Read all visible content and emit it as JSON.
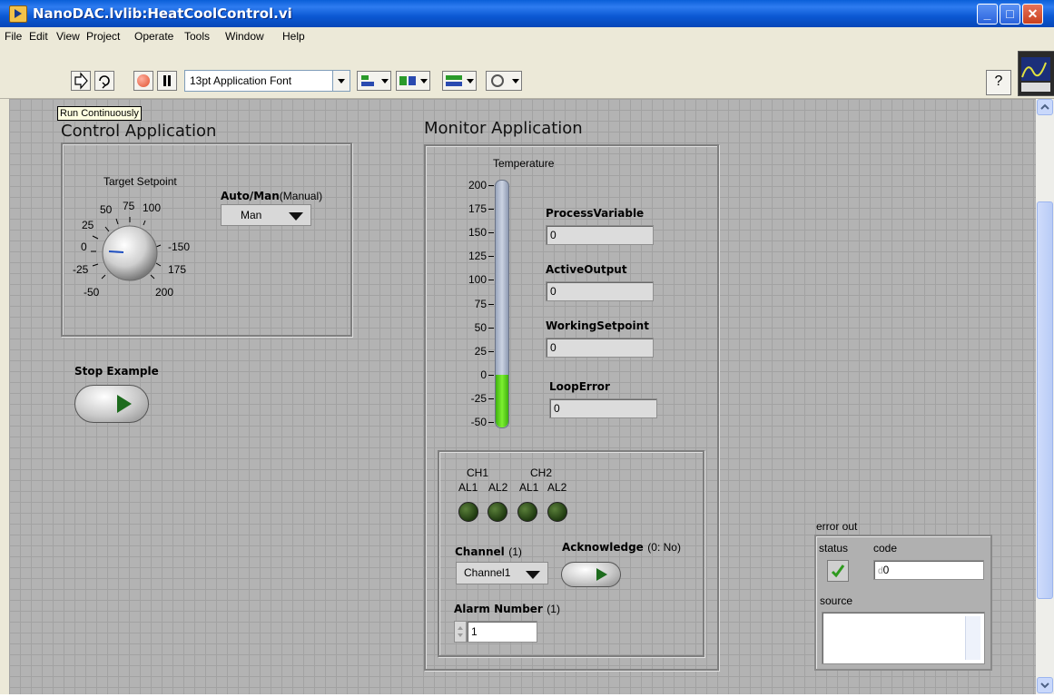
{
  "window": {
    "title": "NanoDAC.lvlib:HeatCoolControl.vi",
    "minimize": "_",
    "maximize": "□",
    "close": "✕"
  },
  "menu": [
    "File",
    "Edit",
    "View",
    "Project",
    "Operate",
    "Tools",
    "Window",
    "Help"
  ],
  "toolbar": {
    "font": "13pt Application Font",
    "tooltip": "Run Continuously",
    "help": "?"
  },
  "control": {
    "heading": "Control Application",
    "knob_label": "Target Setpoint",
    "knob_ticks": [
      "50",
      "75",
      "100",
      "25",
      "0",
      "-150",
      "-25",
      "175",
      "-50",
      "200"
    ],
    "knob_value": 0,
    "auto_man_label": "Auto/Man",
    "auto_man_suffix": "(Manual)",
    "auto_man_value": "Man",
    "stop_label": "Stop Example"
  },
  "monitor": {
    "heading": "Monitor Application",
    "thermo_label": "Temperature",
    "scale": [
      "200",
      "175",
      "150",
      "125",
      "100",
      "75",
      "50",
      "25",
      "0",
      "-25",
      "-50"
    ],
    "temperature_value": 0,
    "process_variable_label": "ProcessVariable",
    "process_variable": "0",
    "active_output_label": "ActiveOutput",
    "active_output": "0",
    "working_setpoint_label": "WorkingSetpoint",
    "working_setpoint": "0",
    "loop_error_label": "LoopError",
    "loop_error": "0"
  },
  "alarms": {
    "ch1": "CH1",
    "ch2": "CH2",
    "al_labels": [
      "AL1",
      "AL2",
      "AL1",
      "AL2"
    ],
    "channel_label": "Channel",
    "channel_suffix": "(1)",
    "channel_value": "Channel1",
    "ack_label": "Acknowledge",
    "ack_suffix": "(0: No)",
    "alarm_number_label": "Alarm Number",
    "alarm_number_suffix": "(1)",
    "alarm_number_value": "1"
  },
  "error_out": {
    "label": "error out",
    "status_label": "status",
    "code_label": "code",
    "code_value": "0",
    "code_prefix": "d",
    "source_label": "source",
    "status_icon": "checkmark-icon"
  },
  "colors": {
    "title_bar": "#0a5fd8",
    "panel_grid": "#b3b3b3",
    "thermo_fill": "#5ce01e",
    "led_off": "#2f4f1d"
  }
}
